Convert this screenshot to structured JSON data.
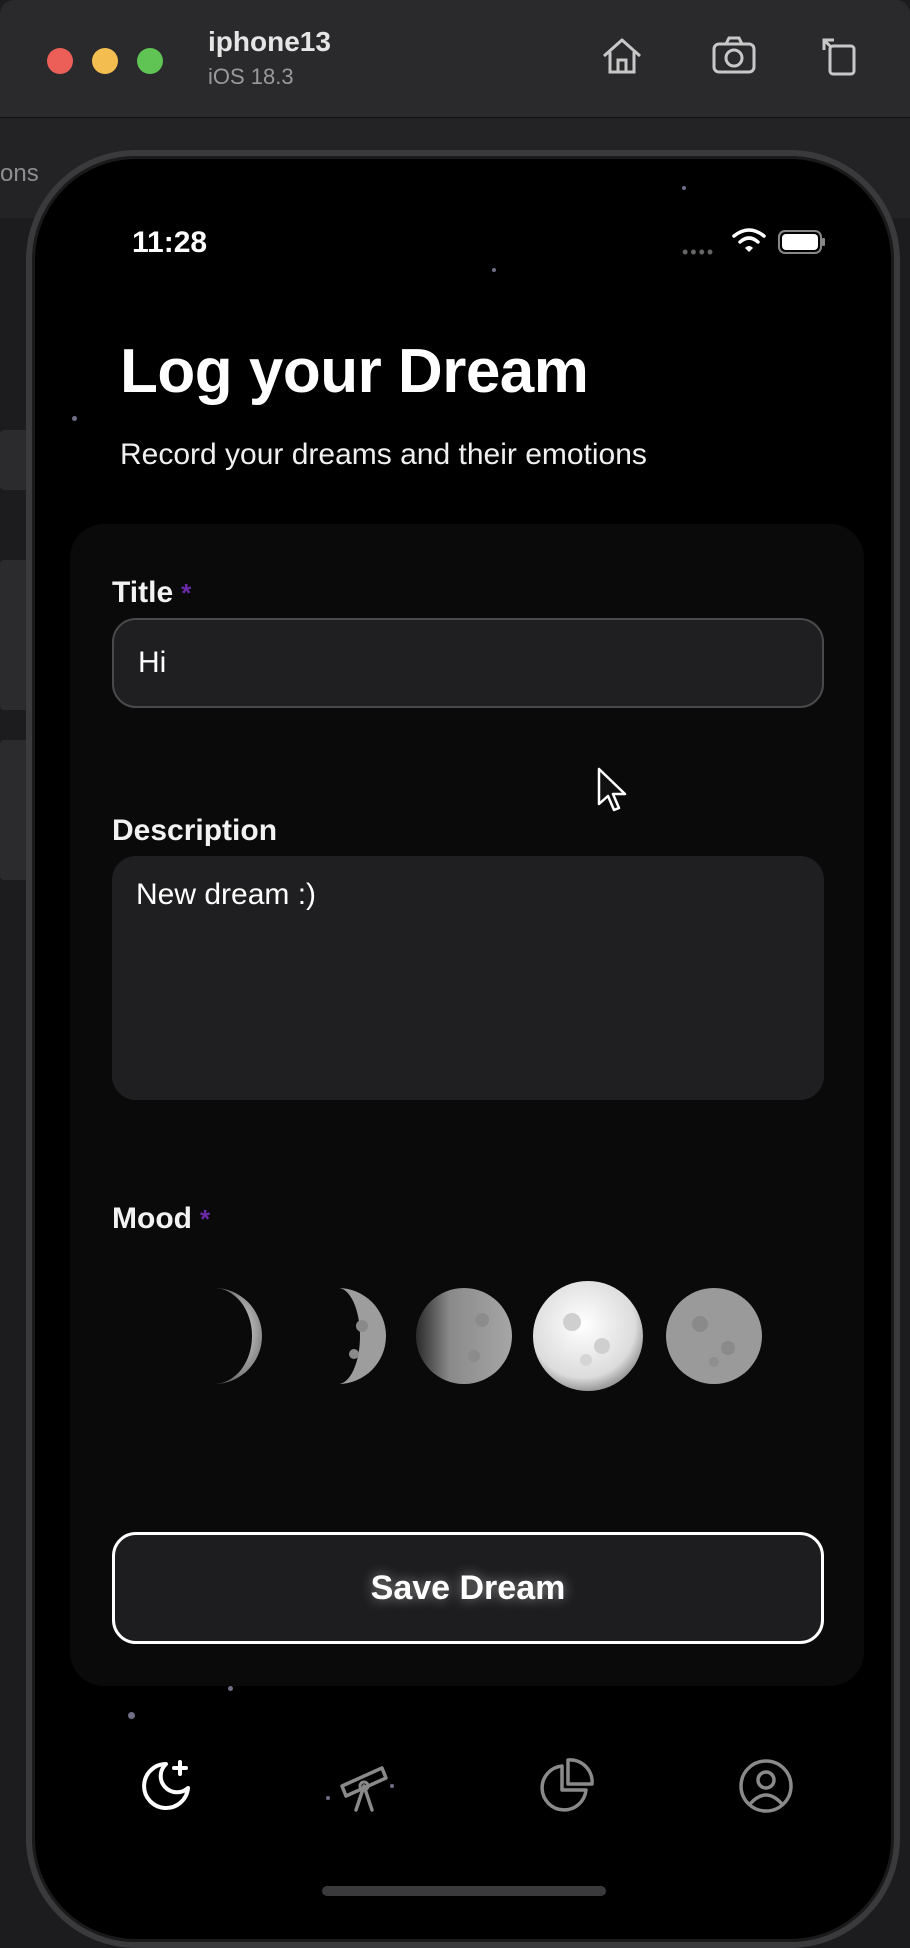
{
  "simulator": {
    "device_name": "iphone13",
    "os_version": "iOS 18.3",
    "toolbar_icons": [
      "home-icon",
      "screenshot-icon",
      "rotate-icon"
    ]
  },
  "host": {
    "partial_text": "ons"
  },
  "status_bar": {
    "time": "11:28",
    "icons": [
      "signal-dots-icon",
      "wifi-icon",
      "battery-icon"
    ]
  },
  "header": {
    "title": "Log your Dream",
    "subtitle": "Record your dreams and their emotions"
  },
  "form": {
    "title_label": "Title",
    "required_mark": "*",
    "title_value": "Hi",
    "description_label": "Description",
    "description_value": "New dream :)",
    "mood_label": "Mood",
    "moods": [
      {
        "name": "waxing-crescent",
        "icon": "crescent-moon-icon",
        "selected": false
      },
      {
        "name": "first-quarter",
        "icon": "half-moon-icon",
        "selected": false
      },
      {
        "name": "waxing-gibbous",
        "icon": "gibbous-moon-icon",
        "selected": false
      },
      {
        "name": "full-bright",
        "icon": "full-moon-icon",
        "selected": true
      },
      {
        "name": "full-dim",
        "icon": "full-moon-icon",
        "selected": false
      }
    ],
    "save_label": "Save Dream"
  },
  "tabbar": {
    "items": [
      {
        "name": "log",
        "icon": "moon-plus-icon",
        "active": true
      },
      {
        "name": "explore",
        "icon": "telescope-icon",
        "active": false
      },
      {
        "name": "stats",
        "icon": "pie-chart-icon",
        "active": false
      },
      {
        "name": "profile",
        "icon": "person-circle-icon",
        "active": false
      }
    ]
  },
  "colors": {
    "background": "#000000",
    "card": "#0a0a0b",
    "input": "#1f1f21",
    "required_accent": "#6a2aa8",
    "text": "#ffffff"
  }
}
